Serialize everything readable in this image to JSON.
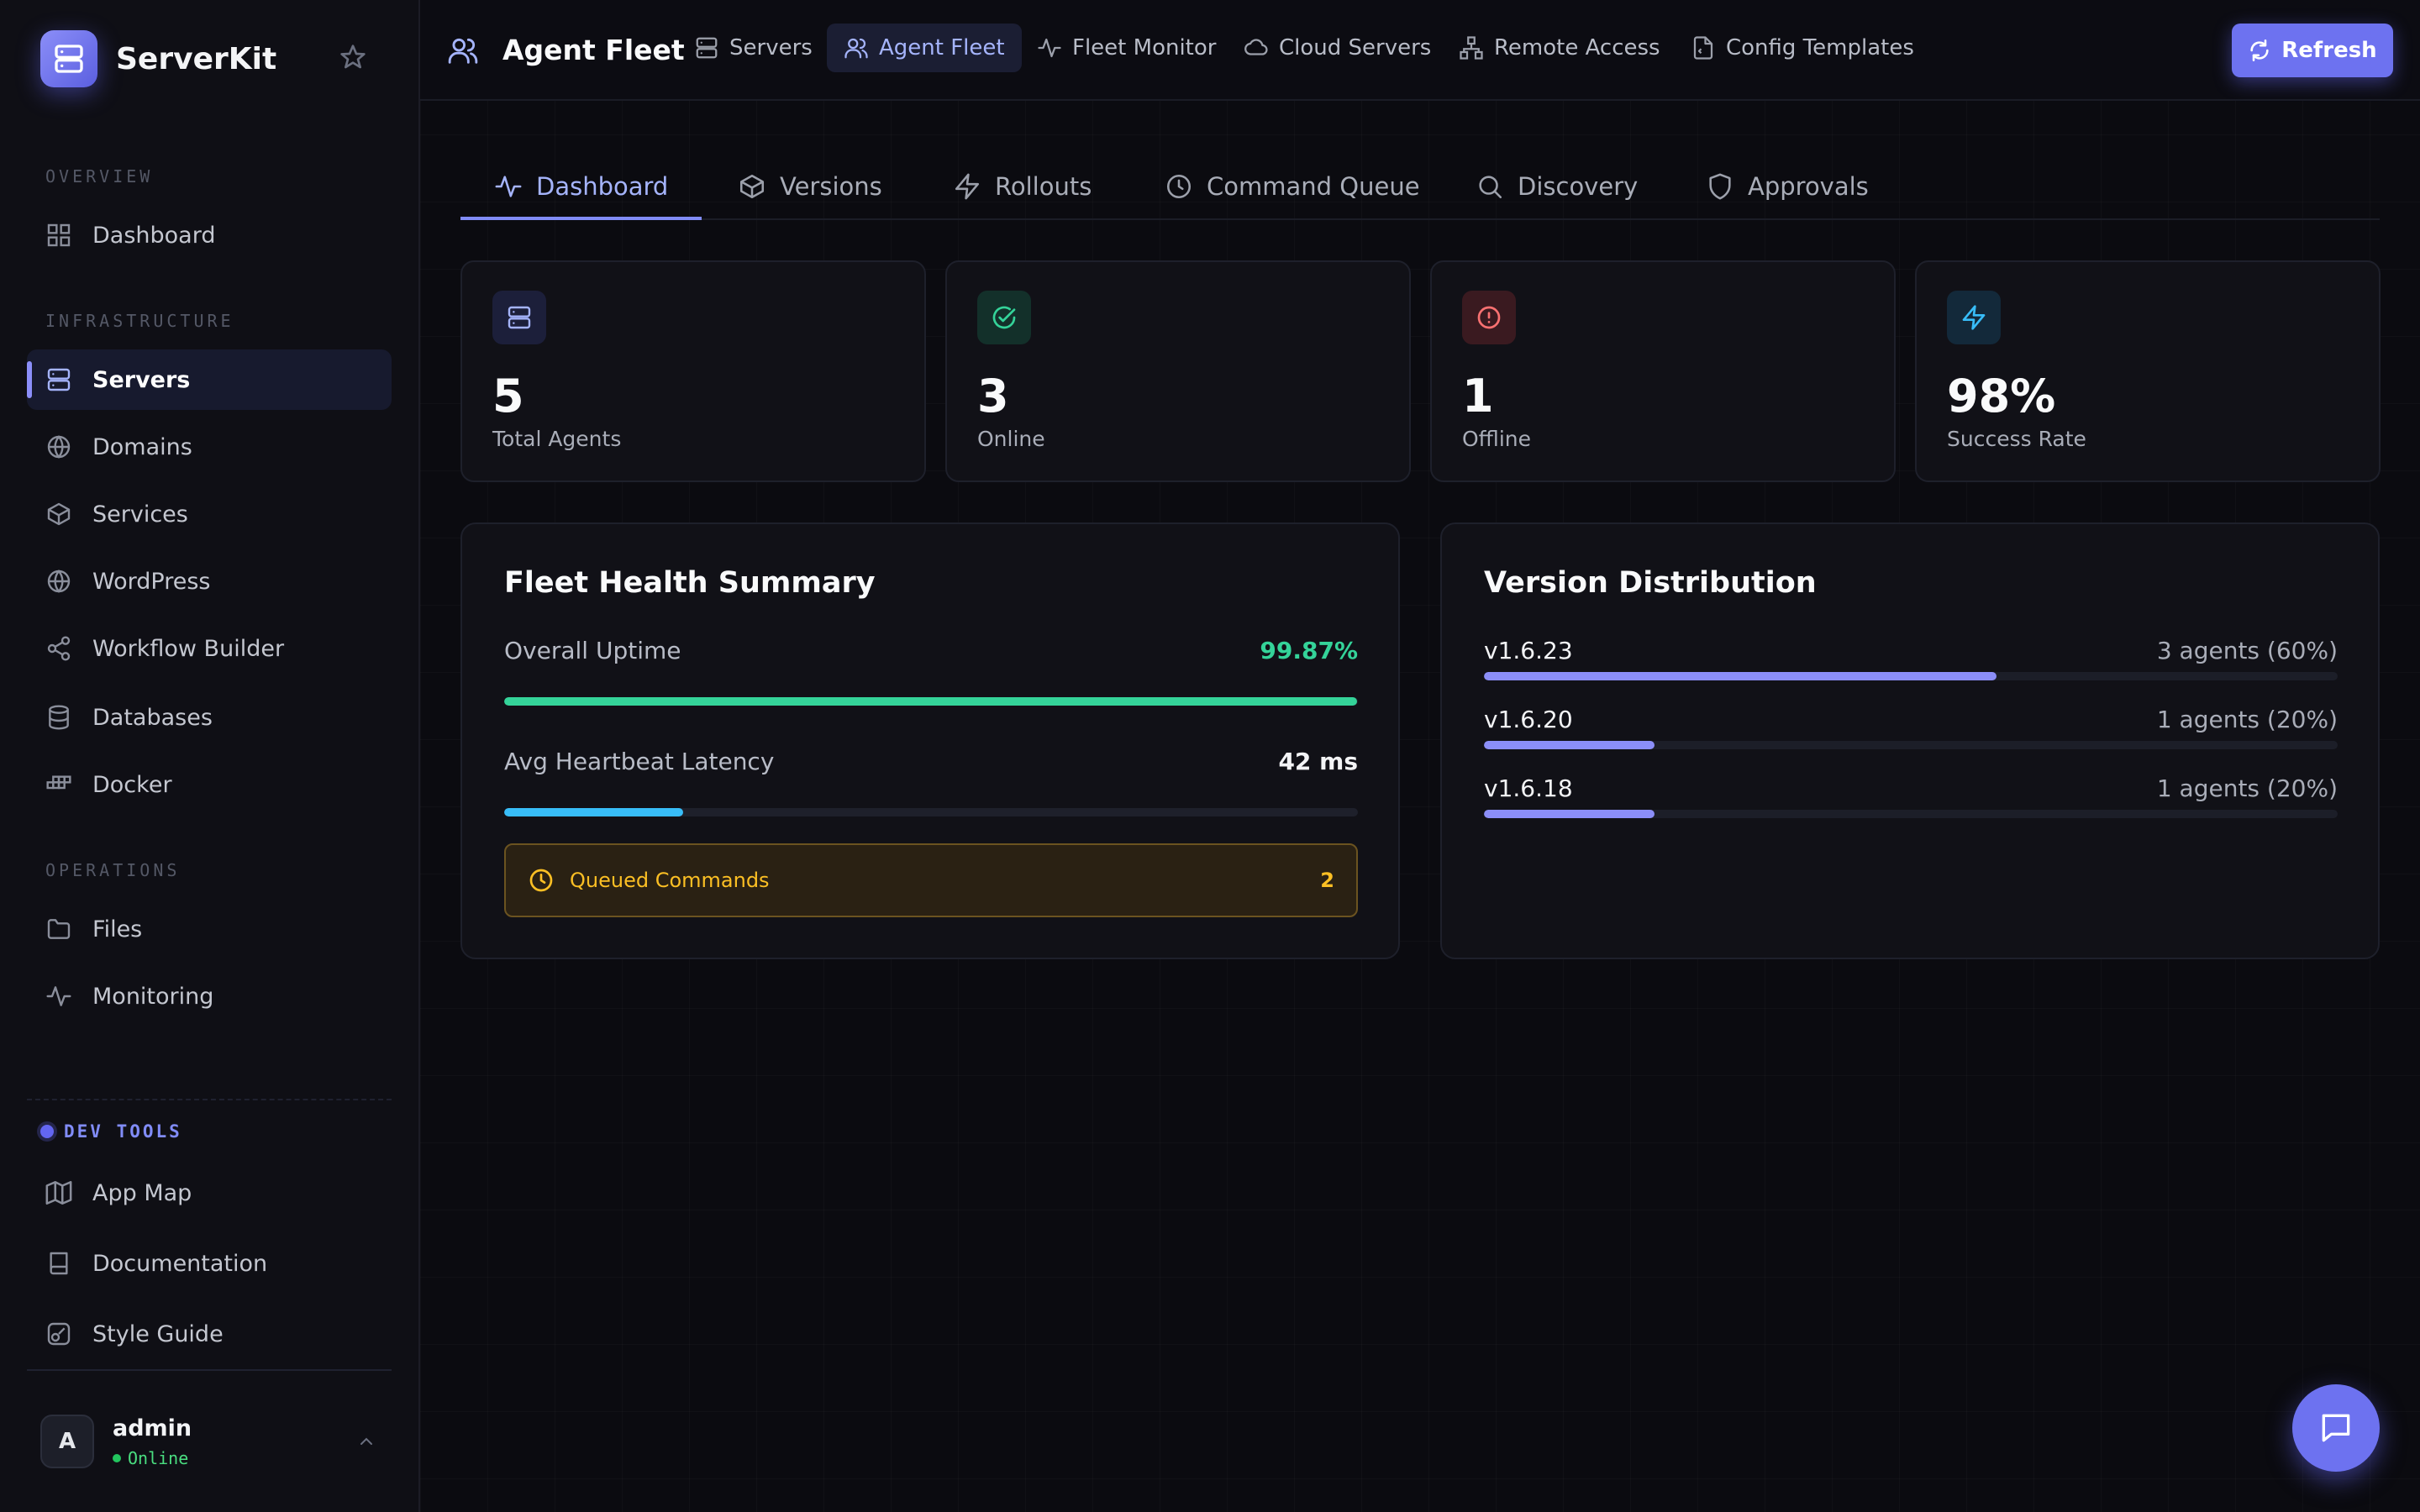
{
  "brand": {
    "name": "ServerKit"
  },
  "sidebar": {
    "sections": {
      "overview": "OVERVIEW",
      "infrastructure": "INFRASTRUCTURE",
      "operations": "OPERATIONS",
      "dev_tools": "DEV TOOLS"
    },
    "items": {
      "dashboard": "Dashboard",
      "servers": "Servers",
      "domains": "Domains",
      "services": "Services",
      "wordpress": "WordPress",
      "workflow_builder": "Workflow Builder",
      "databases": "Databases",
      "docker": "Docker",
      "files": "Files",
      "monitoring": "Monitoring",
      "app_map": "App Map",
      "documentation": "Documentation",
      "style_guide": "Style Guide"
    },
    "user": {
      "initial": "A",
      "name": "admin",
      "status": "Online"
    }
  },
  "header": {
    "title": "Agent Fleet",
    "nav": {
      "servers": "Servers",
      "agent_fleet": "Agent Fleet",
      "fleet_monitor": "Fleet Monitor",
      "cloud_servers": "Cloud Servers",
      "remote_access": "Remote Access",
      "config_templates": "Config Templates"
    },
    "refresh_label": "Refresh"
  },
  "tabs": {
    "dashboard": "Dashboard",
    "versions": "Versions",
    "rollouts": "Rollouts",
    "command_queue": "Command Queue",
    "discovery": "Discovery",
    "approvals": "Approvals"
  },
  "stats": {
    "total": {
      "value": "5",
      "label": "Total Agents"
    },
    "online": {
      "value": "3",
      "label": "Online"
    },
    "offline": {
      "value": "1",
      "label": "Offline"
    },
    "success": {
      "value": "98%",
      "label": "Success Rate"
    }
  },
  "health": {
    "title": "Fleet Health Summary",
    "uptime_label": "Overall Uptime",
    "uptime_value": "99.87%",
    "uptime_fraction": 0.9987,
    "latency_label": "Avg Heartbeat Latency",
    "latency_value": "42 ms",
    "latency_fraction": 0.21,
    "queued_label": "Queued Commands",
    "queued_count": "2"
  },
  "versions": {
    "title": "Version Distribution",
    "rows": [
      {
        "version": "v1.6.23",
        "count": "3 agents (60%)",
        "fraction": 0.6
      },
      {
        "version": "v1.6.20",
        "count": "1 agents (20%)",
        "fraction": 0.2
      },
      {
        "version": "v1.6.18",
        "count": "1 agents (20%)",
        "fraction": 0.2
      }
    ]
  },
  "colors": {
    "accent": "#818cf8",
    "success": "#34d399",
    "danger": "#f87171",
    "info": "#38bdf8",
    "warning": "#fbbf24"
  }
}
